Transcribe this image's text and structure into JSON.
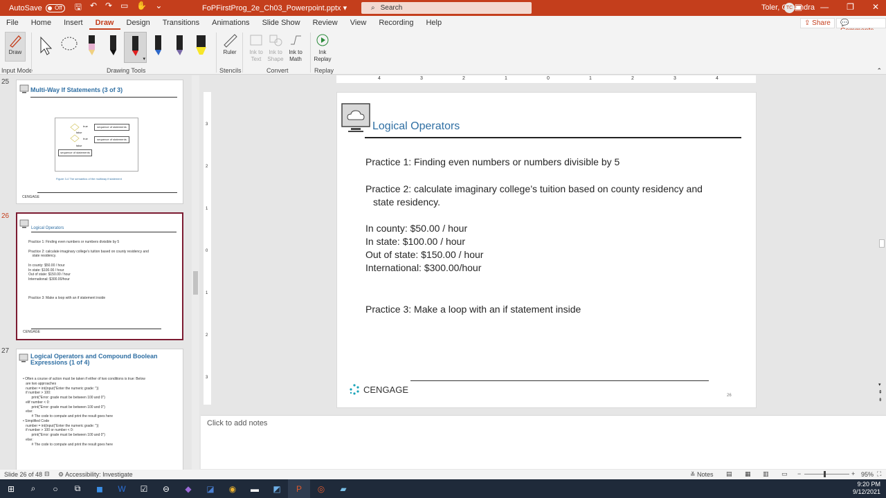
{
  "titlebar": {
    "autosave_label": "AutoSave",
    "autosave_state": "Off",
    "doc_title": "FoPFirstProg_2e_Ch03_Powerpoint.pptx",
    "search_placeholder": "Search",
    "user_name": "Toler, Casandra",
    "user_initials": "TC"
  },
  "tabs": [
    "File",
    "Home",
    "Insert",
    "Draw",
    "Design",
    "Transitions",
    "Animations",
    "Slide Show",
    "Review",
    "View",
    "Recording",
    "Help"
  ],
  "active_tab": "Draw",
  "share_label": "Share",
  "comments_label": "Comments",
  "ribbon": {
    "draw_label": "Draw",
    "input_mode_label": "Input Mode",
    "drawing_tools_label": "Drawing Tools",
    "ruler_label": "Ruler",
    "stencils_label": "Stencils",
    "ink_to_text": "Ink to Text",
    "ink_to_shape": "Ink to Shape",
    "ink_to_math": "Ink to Math",
    "convert_label": "Convert",
    "ink_replay": "Ink Replay",
    "replay_label": "Replay"
  },
  "thumbnails": [
    {
      "num": "25",
      "title": "Multi-Way If Statements (3 of 3)",
      "caption": "Figure 3-4   The semantics of the multiway if statement",
      "box1": "sequence of statements",
      "box2": "sequence of statements",
      "box3": "sequence of statements",
      "t1": "true",
      "t2": "false",
      "t3": "true",
      "t4": "false"
    },
    {
      "num": "26",
      "title": "Logical Operators",
      "body": "Practice 1: Finding even numbers or numbers divisible by 5\n\nPractice 2: calculate imaginary college’s tuition based on county residency and\n    state residency.\n\nIn county: $50.00 / hour\nIn state: $100.00 / hour\nOut of state: $150.00 / hour\nInternational: $300.00/hour\n\n\n\nPractice 3: Make a loop with an if statement inside"
    },
    {
      "num": "27",
      "title": "Logical Operators and Compound Boolean Expressions (1 of 4)",
      "body": "• Often a course of action must be taken if either of two conditions is true: Below\n   are two approaches\n   number = int(input(\"Enter the numeric grade: \"))\n   if number > 100:\n         print(\"Error: grade must be between 100 and 0\")\n   elif number < 0:\n         print(\"Error: grade must be between 100 and 0\")\n   else:\n         # The code to compute and print the result goes here\n• Simplified Code\n   number = int(input(\"Enter the numeric grade: \"))\n   if number > 100 or number < 0:\n         print(\"Error: grade must be between 100 and 0\")\n   else:\n         # The code to compute and print the result goes here"
    }
  ],
  "cengage": "CENGAGE",
  "slide": {
    "title": "Logical Operators",
    "p1": "Practice 1: Finding even numbers or numbers divisible by 5",
    "p2a": "Practice 2: calculate imaginary college’s tuition based on county residency and",
    "p2b": "state residency.",
    "rate1": "In county: $50.00 / hour",
    "rate2": "In state: $100.00 / hour",
    "rate3": "Out of state: $150.00 / hour",
    "rate4": "International: $300.00/hour",
    "p3": "Practice 3: Make a loop with an if statement inside",
    "number": "26"
  },
  "ruler_h": [
    "4",
    "3",
    "2",
    "1",
    "0",
    "1",
    "2",
    "3",
    "4"
  ],
  "ruler_v": [
    "3",
    "2",
    "1",
    "0",
    "1",
    "2",
    "3"
  ],
  "notes_placeholder": "Click to add notes",
  "status": {
    "slide_of": "Slide 26 of 48",
    "accessibility": "Accessibility: Investigate",
    "notes": "Notes",
    "zoom": "95%"
  },
  "clock": {
    "time": "9:20 PM",
    "date": "9/12/2021"
  }
}
